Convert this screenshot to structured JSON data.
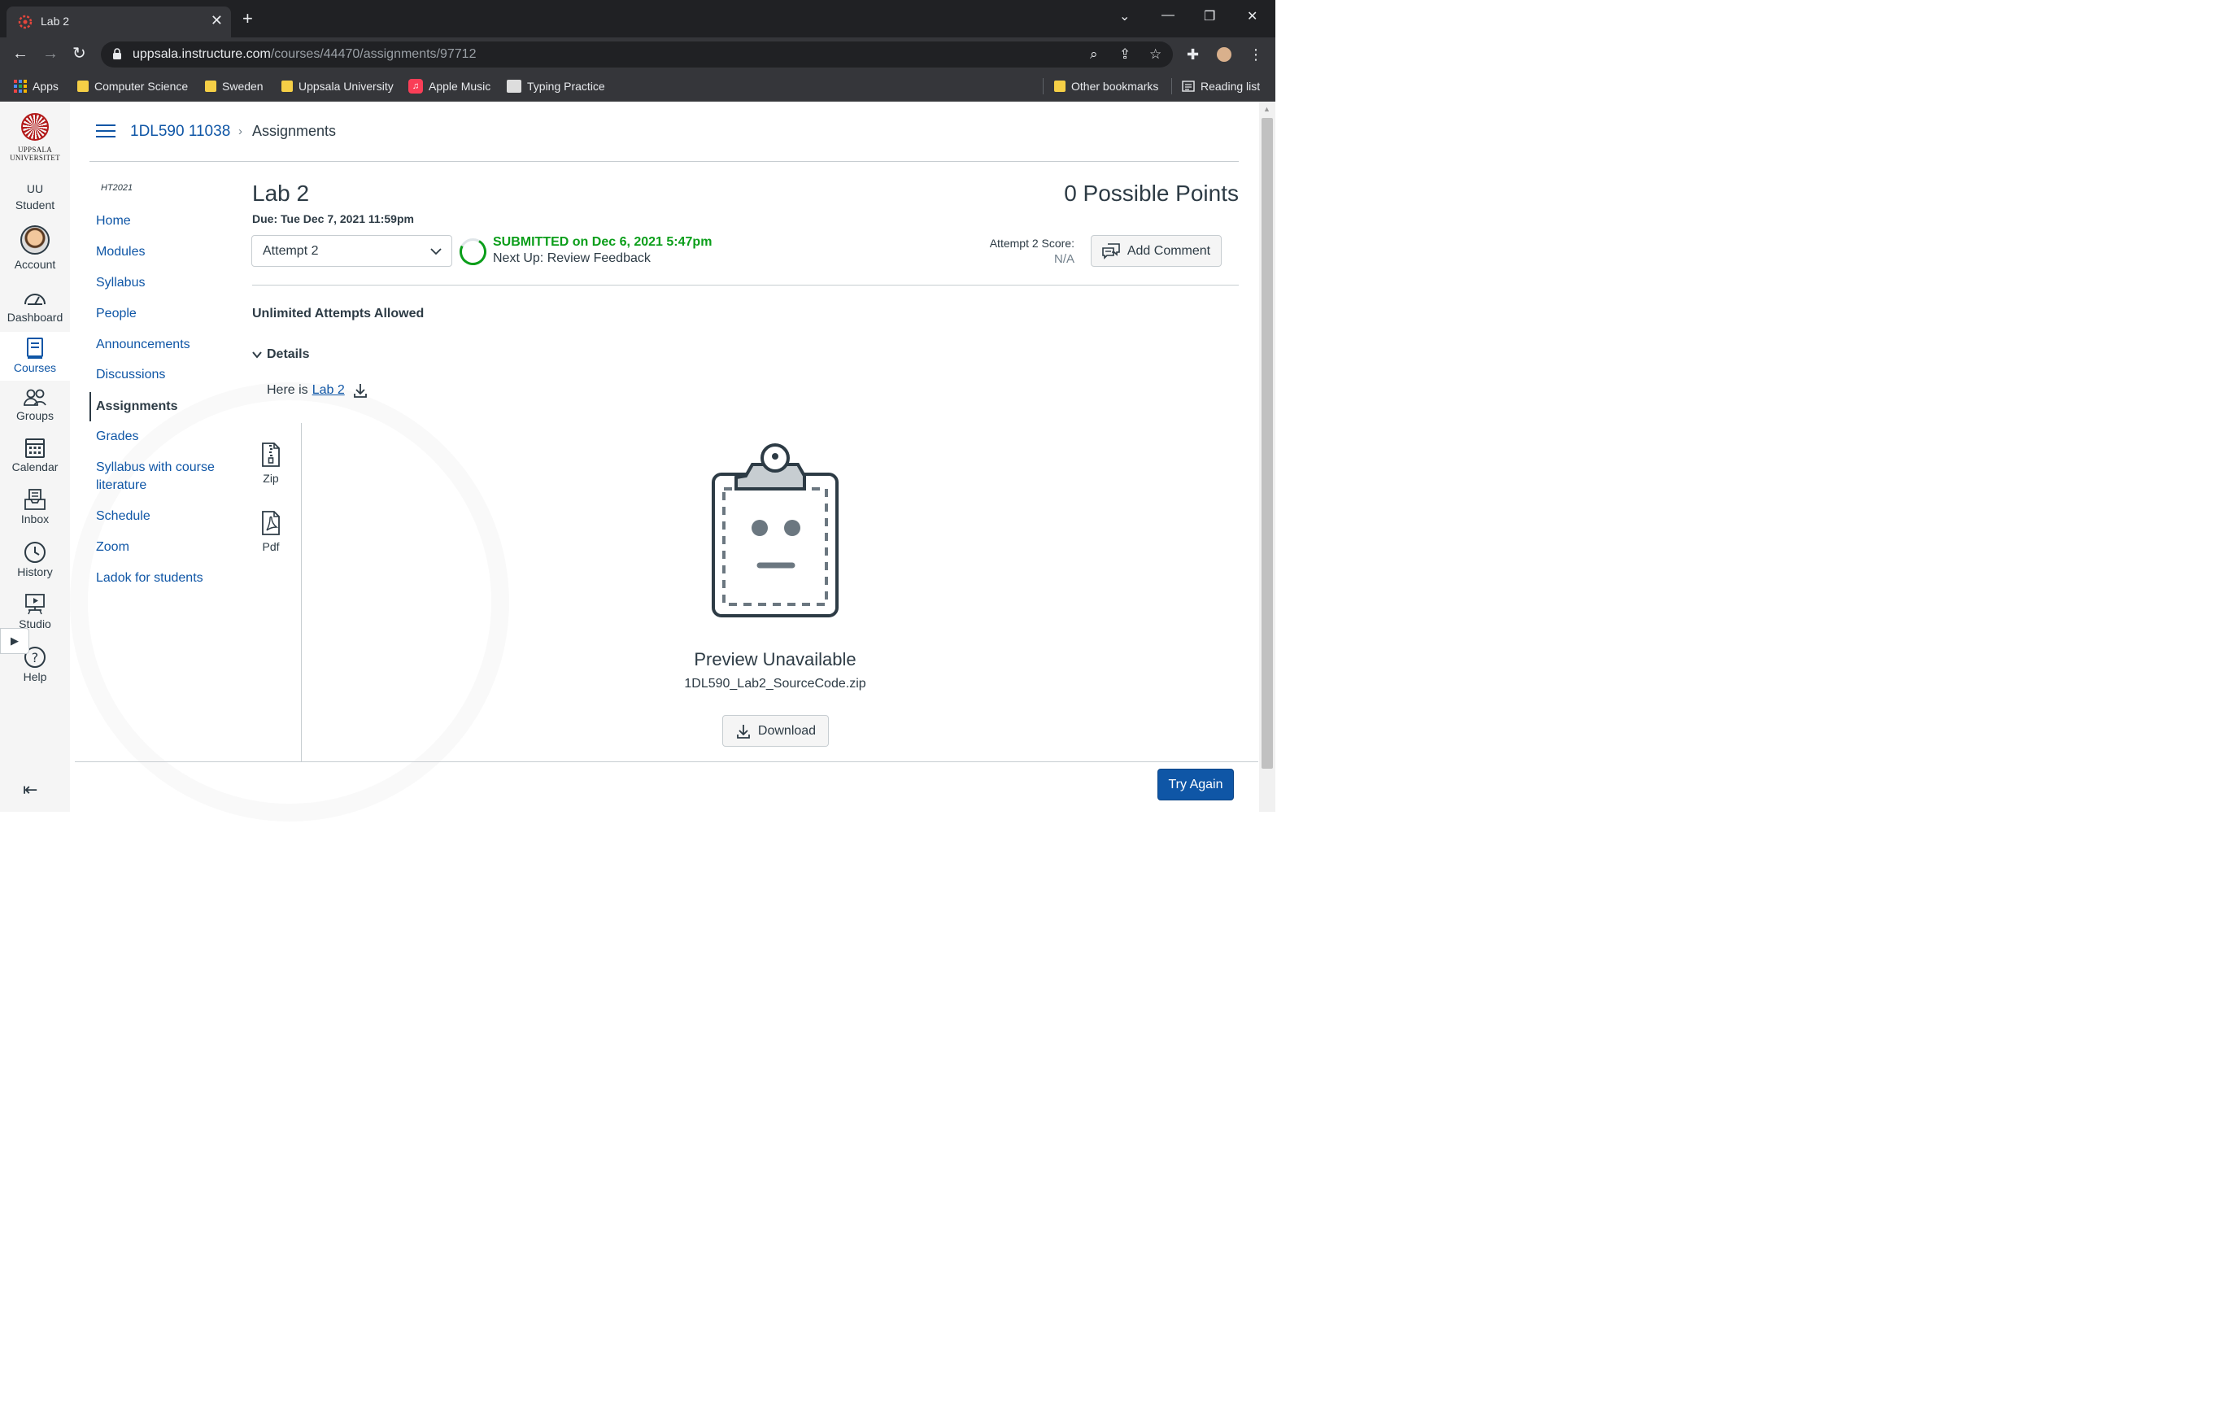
{
  "browser": {
    "tab_title": "Lab 2",
    "url_host": "uppsala.instructure.com",
    "url_path": "/courses/44470/assignments/97712",
    "bookmarks": [
      "Apps",
      "Computer Science",
      "Sweden",
      "Uppsala University",
      "Apple Music",
      "Typing Practice"
    ],
    "other_bookmarks": "Other bookmarks",
    "reading_list": "Reading list"
  },
  "global_nav": {
    "logo_line1": "UPPSALA",
    "logo_line2": "UNIVERSITET",
    "items": [
      {
        "label": "UU Student"
      },
      {
        "label": "Account"
      },
      {
        "label": "Dashboard"
      },
      {
        "label": "Courses"
      },
      {
        "label": "Groups"
      },
      {
        "label": "Calendar"
      },
      {
        "label": "Inbox"
      },
      {
        "label": "History"
      },
      {
        "label": "Studio"
      },
      {
        "label": "Help"
      }
    ]
  },
  "breadcrumb": {
    "course": "1DL590 11038",
    "current": "Assignments"
  },
  "course_nav": {
    "term": "HT2021",
    "items": [
      {
        "label": "Home"
      },
      {
        "label": "Modules"
      },
      {
        "label": "Syllabus"
      },
      {
        "label": "People"
      },
      {
        "label": "Announcements"
      },
      {
        "label": "Discussions"
      },
      {
        "label": "Assignments"
      },
      {
        "label": "Grades"
      },
      {
        "label": "Syllabus with course literature"
      },
      {
        "label": "Schedule"
      },
      {
        "label": "Zoom"
      },
      {
        "label": "Ladok for students"
      }
    ]
  },
  "assignment": {
    "title": "Lab 2",
    "points": "0 Possible Points",
    "due": "Due: Tue Dec 7, 2021 11:59pm",
    "attempt_selected": "Attempt 2",
    "status": "SUBMITTED on Dec 6, 2021 5:47pm",
    "next_up": "Next Up: Review Feedback",
    "score_label": "Attempt 2 Score:",
    "score_value": "N/A",
    "add_comment": "Add Comment",
    "attempts_info": "Unlimited Attempts Allowed",
    "details_label": "Details",
    "details_text": "Here is",
    "details_link": "Lab 2",
    "files": [
      {
        "label": "Zip"
      },
      {
        "label": "Pdf"
      }
    ],
    "preview_title": "Preview Unavailable",
    "preview_file": "1DL590_Lab2_SourceCode.zip",
    "download": "Download",
    "try_again": "Try Again"
  },
  "colors": {
    "link": "#0f56a6",
    "submitted": "#0b9e1a",
    "text": "#2d3b45",
    "primary_button": "#0f56a6"
  }
}
